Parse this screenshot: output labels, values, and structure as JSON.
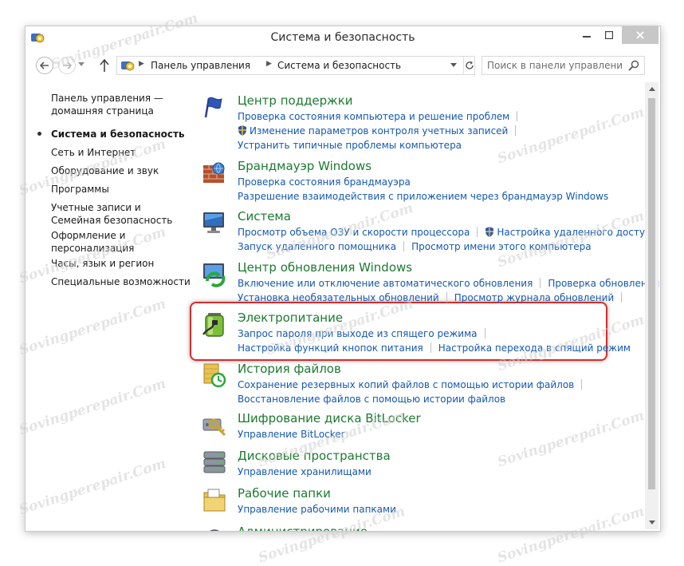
{
  "window": {
    "title": "Система и безопасность"
  },
  "address_bar": {
    "crumbs": [
      "Панель управления",
      "Система и безопасность"
    ],
    "search_placeholder": "Поиск в панели управления"
  },
  "left_nav": {
    "items": [
      {
        "label": "Панель управления — домашняя страница",
        "active": false
      },
      {
        "label": "Система и безопасность",
        "active": true
      },
      {
        "label": "Сеть и Интернет",
        "active": false
      },
      {
        "label": "Оборудование и звук",
        "active": false
      },
      {
        "label": "Программы",
        "active": false
      },
      {
        "label": "Учетные записи и Семейная безопасность",
        "active": false
      },
      {
        "label": "Оформление и персонализация",
        "active": false
      },
      {
        "label": "Часы, язык и регион",
        "active": false
      },
      {
        "label": "Специальные возможности",
        "active": false
      }
    ]
  },
  "categories": [
    {
      "title": "Центр поддержки",
      "icon": "flag-icon",
      "rows": [
        [
          "Проверка состояния компьютера и решение проблем"
        ],
        [
          "Изменение параметров контроля учетных записей"
        ],
        [
          "Устранить типичные проблемы компьютера"
        ]
      ]
    },
    {
      "title": "Брандмауэр Windows",
      "icon": "firewall-icon",
      "rows": [
        [
          "Проверка состояния брандмауэра"
        ],
        [
          "Разрешение взаимодействия с приложением через брандмауэр Windows"
        ]
      ]
    },
    {
      "title": "Система",
      "icon": "system-icon",
      "rows": [
        [
          "Просмотр объема ОЗУ и скорости процессора",
          "Настройка удаленного доступа"
        ],
        [
          "Запуск удаленного помощника",
          "Просмотр имени этого компьютера"
        ]
      ]
    },
    {
      "title": "Центр обновления Windows",
      "icon": "windows-update-icon",
      "rows": [
        [
          "Включение или отключение автоматического обновления",
          "Проверка обновлений"
        ],
        [
          "Установка необязательных обновлений",
          "Просмотр журнала обновлений"
        ]
      ]
    },
    {
      "title": "Электропитание",
      "icon": "battery-icon",
      "rows": [
        [
          "Запрос пароля при выходе из спящего режима"
        ],
        [
          "Настройка функций кнопок питания",
          "Настройка перехода в спящий режим"
        ]
      ]
    },
    {
      "title": "История файлов",
      "icon": "file-history-icon",
      "rows": [
        [
          "Сохранение резервных копий файлов с помощью истории файлов"
        ],
        [
          "Восстановление файлов с помощью истории файлов"
        ]
      ]
    },
    {
      "title": "Шифрование диска BitLocker",
      "icon": "bitlocker-icon",
      "rows": [
        [
          "Управление BitLocker"
        ]
      ]
    },
    {
      "title": "Дисковые пространства",
      "icon": "storage-spaces-icon",
      "rows": [
        [
          "Управление хранилищами"
        ]
      ]
    },
    {
      "title": "Рабочие папки",
      "icon": "work-folders-icon",
      "rows": [
        [
          "Управление рабочими папками"
        ]
      ]
    },
    {
      "title": "Администрирование",
      "icon": "admin-tools-icon",
      "rows": []
    }
  ],
  "watermark": "Sovingperepair.Com",
  "colors": {
    "category_title": "#1c7a30",
    "link": "#1558b0",
    "highlight": "#d92b2b"
  }
}
